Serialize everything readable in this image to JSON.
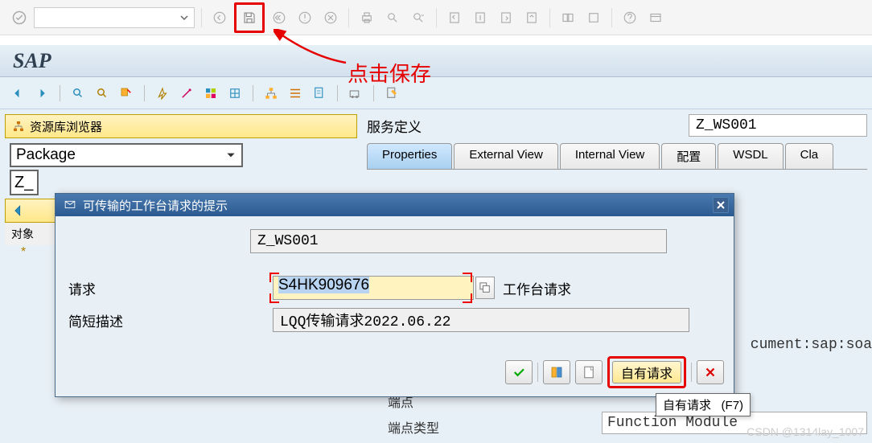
{
  "annotation": {
    "save_hint": "点击保存"
  },
  "sap_logo": "SAP",
  "left": {
    "browser_title": "资源库浏览器",
    "package_label": "Package",
    "z_prefix": "Z_",
    "obj_label": "对象",
    "star": "*"
  },
  "right": {
    "service_def_label": "服务定义",
    "service_def_value": "Z_WS001",
    "tabs": [
      "Properties",
      "External View",
      "Internal View",
      "配置",
      "WSDL",
      "Cla"
    ],
    "bg_text1": "cument:sap:soa",
    "endpoint_label": "端点",
    "endpoint_type_label": "端点类型",
    "endpoint_type_value": "Function Module"
  },
  "dialog": {
    "title": "可传输的工作台请求的提示",
    "object_value": "Z_WS001",
    "request_label": "请求",
    "request_value": "S4HK909676",
    "request_type": "工作台请求",
    "desc_label": "简短描述",
    "desc_value": "LQQ传输请求2022.06.22",
    "own_request_btn": "自有请求"
  },
  "tooltip": {
    "text": "自有请求",
    "key": "(F7)"
  },
  "watermark": "CSDN @1314lay_1007"
}
